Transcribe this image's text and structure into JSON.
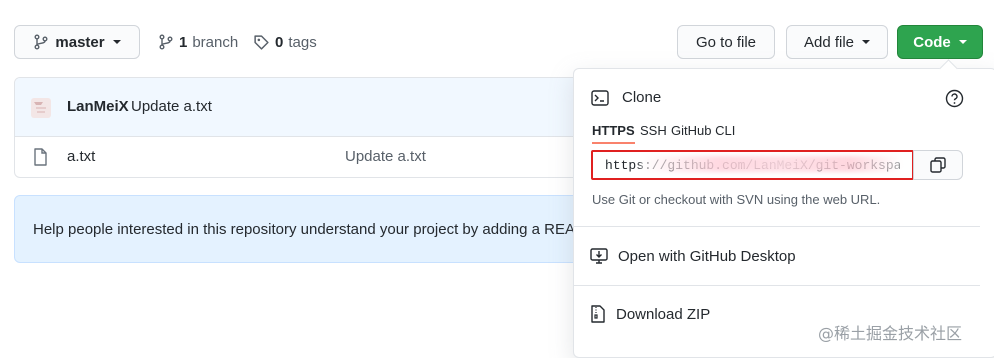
{
  "toolbar": {
    "branch_select": "master",
    "branch_count": "1",
    "branch_word": "branch",
    "tag_count": "0",
    "tag_word": "tags",
    "go_to_file": "Go to file",
    "add_file": "Add file",
    "code": "Code"
  },
  "commit": {
    "author": "LanMeiX",
    "message": "Update a.txt"
  },
  "files": [
    {
      "name": "a.txt",
      "message": "Update a.txt"
    }
  ],
  "readme_banner": "Help people interested in this repository understand your project by adding a README.",
  "clone_panel": {
    "title": "Clone",
    "tabs": [
      "HTTPS",
      "SSH",
      "GitHub CLI"
    ],
    "active_tab": "HTTPS",
    "url_value": "https://github.com/LanMeiX/git-workspace.git",
    "hint": "Use Git or checkout with SVN using the web URL.",
    "open_desktop": "Open with GitHub Desktop",
    "download_zip": "Download ZIP"
  },
  "watermark": "@稀土掘金技术社区",
  "colors": {
    "code_button": "#2ea44f",
    "highlight_border": "#e02020",
    "readme_bg": "#e4f2ff",
    "active_tab_underline": "#f9826c"
  },
  "icons": {
    "branch": "git-branch-icon",
    "tag": "tag-icon",
    "file": "file-icon",
    "terminal": "terminal-icon",
    "help": "question-icon",
    "copy": "copy-icon",
    "desktop": "desktop-download-icon",
    "zip": "file-zip-icon"
  }
}
